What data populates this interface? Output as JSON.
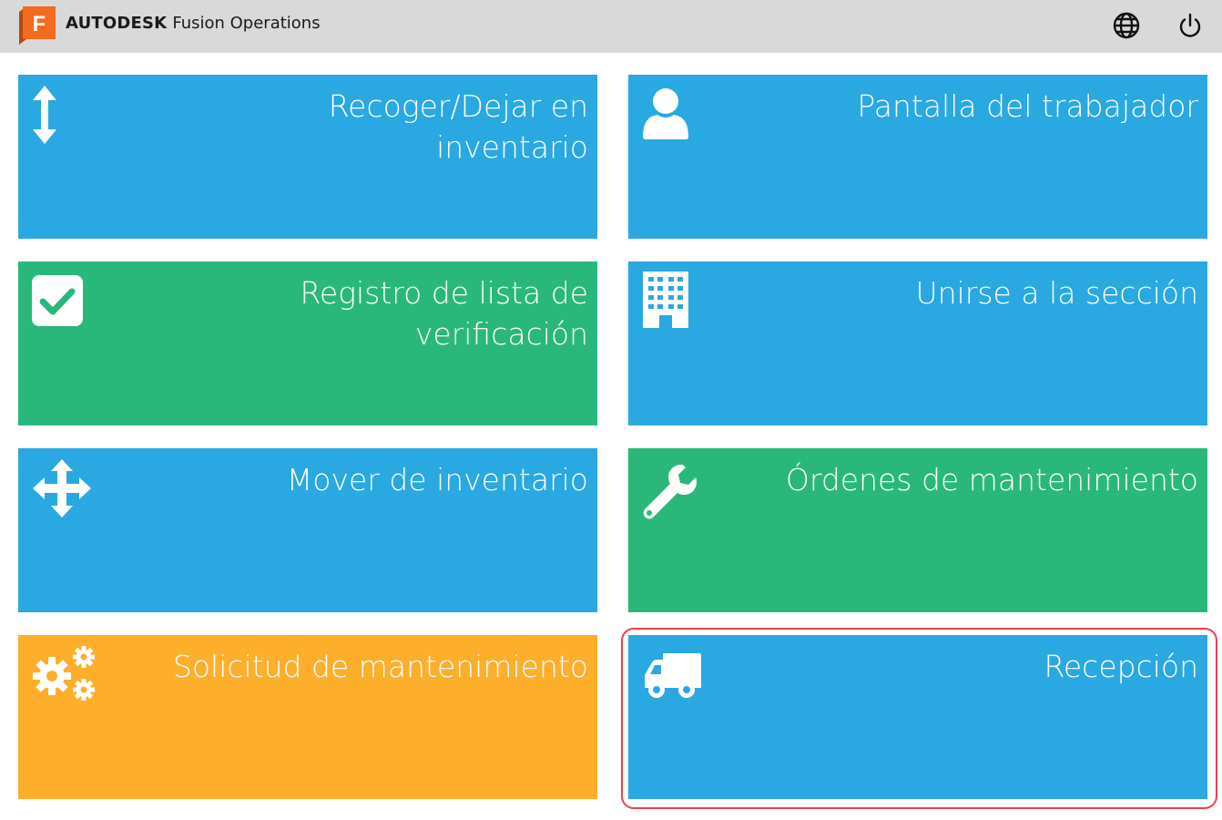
{
  "header": {
    "brand_bold": "AUTODESK",
    "brand_product": "Fusion Operations",
    "logo_letter": "F",
    "icons": [
      "globe-icon",
      "power-icon"
    ]
  },
  "tiles": [
    {
      "label": "Recoger/Dejar en inventario",
      "color": "#29a8e1",
      "icon": "vertical-arrows-icon"
    },
    {
      "label": "Pantalla del trabajador",
      "color": "#29a8e1",
      "icon": "user-icon"
    },
    {
      "label": "Registro de lista de verificación",
      "color": "#29b87a",
      "icon": "checkbox-icon"
    },
    {
      "label": "Unirse a la sección",
      "color": "#29a8e1",
      "icon": "building-icon"
    },
    {
      "label": "Mover de inventario",
      "color": "#29a8e1",
      "icon": "move-arrows-icon"
    },
    {
      "label": "Órdenes de mantenimiento",
      "color": "#29b87a",
      "icon": "wrench-icon"
    },
    {
      "label": "Solicitud de mantenimiento",
      "color": "#fdae2b",
      "icon": "gears-icon"
    },
    {
      "label": "Recepción",
      "color": "#29a8e1",
      "icon": "truck-icon"
    }
  ],
  "colors": {
    "blue": "#29a8e1",
    "green": "#29b87a",
    "orange": "#fdae2b",
    "logo_orange": "#f26b21",
    "highlight_red": "#e8434f",
    "topbar": "#d9d9d9"
  }
}
